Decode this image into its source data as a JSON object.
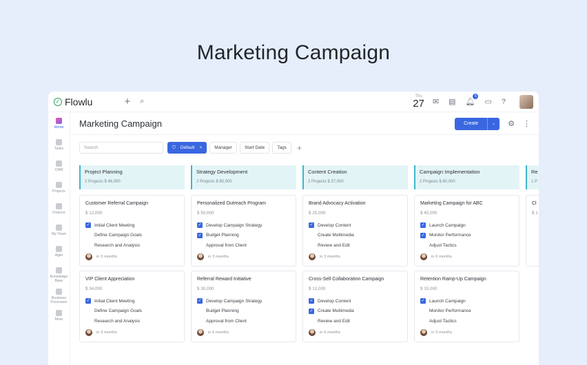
{
  "hero": {
    "title": "Marketing Campaign"
  },
  "app": {
    "logo": "Flowlu",
    "date_dow": "Thu",
    "date_num": "27",
    "notifications_count": "5"
  },
  "sidebar": {
    "items": [
      {
        "label": "Home",
        "icon": "home-icon",
        "active": true
      },
      {
        "label": "Tasks",
        "icon": "tasks-icon"
      },
      {
        "label": "CRM",
        "icon": "crm-icon"
      },
      {
        "label": "Projects",
        "icon": "projects-icon"
      },
      {
        "label": "Finance",
        "icon": "finance-icon"
      },
      {
        "label": "My Team",
        "icon": "team-icon"
      },
      {
        "label": "Agile",
        "icon": "agile-icon"
      },
      {
        "label": "Knowledge Base",
        "icon": "knowledge-icon"
      },
      {
        "label": "Business Processes",
        "icon": "processes-icon"
      },
      {
        "label": "More",
        "icon": "more-icon"
      }
    ]
  },
  "page": {
    "title": "Marketing Campaign",
    "create_label": "Create"
  },
  "filters": {
    "search_placeholder": "Search",
    "default_label": "Default",
    "chips": [
      "Manager",
      "Start Date",
      "Tags"
    ]
  },
  "columns": [
    {
      "title": "Project Planning",
      "meta": "2 Projects   $ 46,000",
      "cards": [
        {
          "title": "Customer Referral Campaign",
          "amount": "$ 12,000",
          "tasks": [
            {
              "label": "Initial Client Meeting",
              "done": true
            },
            {
              "label": "Define Campaign Goals",
              "done": false
            },
            {
              "label": "Research and Analysis",
              "done": false
            }
          ],
          "due": "in 3 months"
        },
        {
          "title": "VIP Client Appreciation",
          "amount": "$ 34,000",
          "tasks": [
            {
              "label": "Initial Client Meeting",
              "done": true
            },
            {
              "label": "Define Campaign Goals",
              "done": false
            },
            {
              "label": "Research and Analysis",
              "done": false
            }
          ],
          "due": "in 3 months"
        }
      ]
    },
    {
      "title": "Strategy Development",
      "meta": "2 Projects   $ 80,000",
      "cards": [
        {
          "title": "Personalized Outreach Program",
          "amount": "$ 50,000",
          "tasks": [
            {
              "label": "Develop Campaign Strategy",
              "done": true
            },
            {
              "label": "Budget Planning",
              "done": true
            },
            {
              "label": "Approval from Client",
              "done": false
            }
          ],
          "due": "in 3 months"
        },
        {
          "title": "Referral Reward Initiative",
          "amount": "$ 30,000",
          "tasks": [
            {
              "label": "Develop Campaign Strategy",
              "done": true
            },
            {
              "label": "Budget Planning",
              "done": false
            },
            {
              "label": "Approval from Client",
              "done": false
            }
          ],
          "due": "in 6 months"
        }
      ]
    },
    {
      "title": "Content Creation",
      "meta": "2 Projects   $ 37,000",
      "cards": [
        {
          "title": "Brand Advocacy Activation",
          "amount": "$ 25,000",
          "tasks": [
            {
              "label": "Develop Content",
              "done": true
            },
            {
              "label": "Create Multimedia",
              "done": false
            },
            {
              "label": "Review and Edit",
              "done": false
            }
          ],
          "due": "in 3 months"
        },
        {
          "title": "Cross-Sell Collaboration Campaign",
          "amount": "$ 12,000",
          "tasks": [
            {
              "label": "Develop Content",
              "done": true
            },
            {
              "label": "Create Multimedia",
              "done": true
            },
            {
              "label": "Review and Edit",
              "done": false
            }
          ],
          "due": "in 6 months"
        }
      ]
    },
    {
      "title": "Campaign Implementation",
      "meta": "2 Projects   $ 60,000",
      "cards": [
        {
          "title": "Marketing Campaign for ABC",
          "amount": "$ 45,000",
          "tasks": [
            {
              "label": "Launch Campaign",
              "done": true
            },
            {
              "label": "Monitor Performance",
              "done": true
            },
            {
              "label": "Adjust Tactics",
              "done": false
            }
          ],
          "due": "in 6 months"
        },
        {
          "title": "Retention Ramp-Up Campaign",
          "amount": "$ 15,000",
          "tasks": [
            {
              "label": "Launch Campaign",
              "done": true
            },
            {
              "label": "Monitor Performance",
              "done": false
            },
            {
              "label": "Adjust Tactics",
              "done": false
            }
          ],
          "due": "in 9 months"
        }
      ]
    },
    {
      "title": "Re",
      "meta": "1 P",
      "cards": [
        {
          "title": "Cl",
          "amount": "$ 1",
          "tasks": [],
          "due": ""
        }
      ]
    }
  ]
}
